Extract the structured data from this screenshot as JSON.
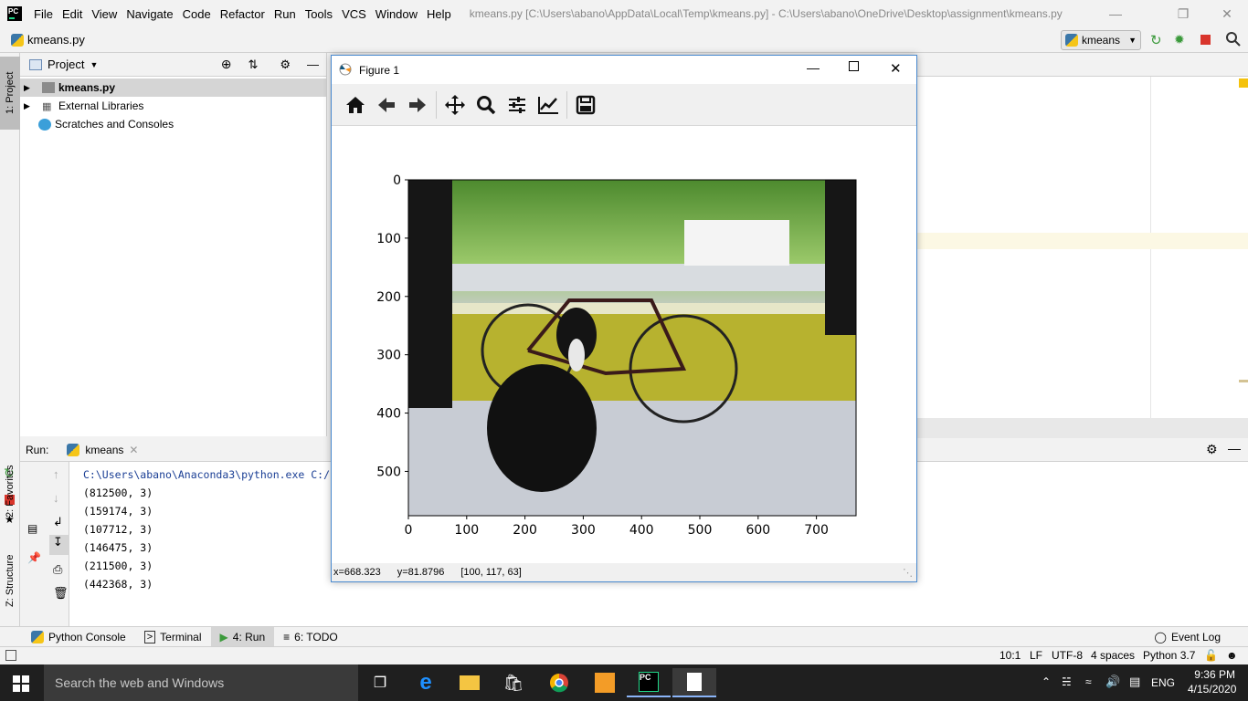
{
  "menubar": {
    "items": [
      "File",
      "Edit",
      "View",
      "Navigate",
      "Code",
      "Refactor",
      "Run",
      "Tools",
      "VCS",
      "Window",
      "Help"
    ],
    "title": "kmeans.py [C:\\Users\\abano\\AppData\\Local\\Temp\\kmeans.py] - C:\\Users\\abano\\OneDrive\\Desktop\\assignment\\kmeans.py"
  },
  "navbar": {
    "file": "kmeans.py",
    "run_config": "kmeans"
  },
  "left_stripe": {
    "project_tab": "1: Project",
    "favorites_tab": "2: Favorites",
    "structure_tab": "Z: Structure"
  },
  "project": {
    "header": "Project",
    "items": [
      {
        "label": "kmeans.py",
        "selected": true
      },
      {
        "label": "External Libraries",
        "selected": false
      },
      {
        "label": "Scratches and Consoles",
        "selected": false
      }
    ]
  },
  "run": {
    "label": "Run:",
    "tab": "kmeans",
    "console": [
      "C:\\Users\\abano\\Anaconda3\\python.exe C:/",
      "(812500, 3)",
      "(159174, 3)",
      "(107712, 3)",
      "(146475, 3)",
      "(211500, 3)",
      "(442368, 3)"
    ]
  },
  "bottom_tools": [
    {
      "label": "Python Console",
      "active": false
    },
    {
      "label": "Terminal",
      "active": false
    },
    {
      "label": "4: Run",
      "active": true
    },
    {
      "label": "6: TODO",
      "active": false
    }
  ],
  "event_log": "Event Log",
  "statusbar": {
    "position": "10:1",
    "line_sep": "LF",
    "encoding": "UTF-8",
    "indent": "4 spaces",
    "interpreter": "Python 3.7"
  },
  "figure": {
    "title": "Figure 1",
    "toolbar": [
      "home-icon",
      "back-icon",
      "forward-icon",
      "pan-icon",
      "zoom-icon",
      "configure-icon",
      "edit-axis-icon",
      "save-icon"
    ],
    "status": {
      "x": "x=668.323",
      "y": "y=81.8796",
      "pixel": "[100, 117, 63]"
    },
    "chart_data": {
      "type": "image",
      "xticks": [
        "0",
        "100",
        "200",
        "300",
        "400",
        "500",
        "600",
        "700"
      ],
      "yticks": [
        "0",
        "100",
        "200",
        "300",
        "400",
        "500"
      ],
      "xlim": [
        0,
        768
      ],
      "ylim": [
        576,
        0
      ]
    }
  },
  "taskbar": {
    "search": "Search the web and Windows",
    "language": "ENG",
    "time": "9:36 PM",
    "date": "4/15/2020"
  }
}
